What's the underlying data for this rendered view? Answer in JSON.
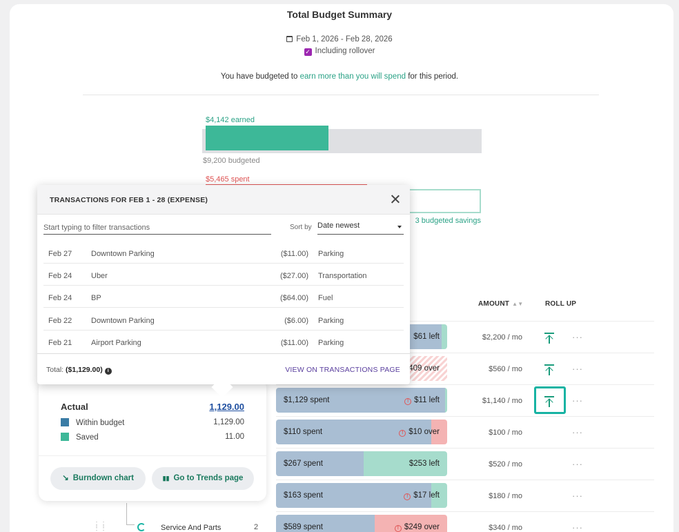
{
  "summary": {
    "title": "Total Budget Summary",
    "date_range": "Feb 1, 2026 - Feb 28, 2026",
    "rollover_label": "Including rollover",
    "message_prefix": "You have budgeted to ",
    "message_highlight": "earn more than you will spend",
    "message_suffix": " for this period.",
    "earned_label": "$4,142 earned",
    "budgeted_label": "$9,200 budgeted",
    "spent_label": "$5,465 spent",
    "savings_label": "3 budgeted savings",
    "earned_fraction": 0.45
  },
  "table": {
    "amount_header": "AMOUNT",
    "rollup_header": "ROLL UP",
    "rows": [
      {
        "bar_right": "$61 left",
        "amount": "$2,200 / mo",
        "rollup": true
      },
      {
        "bar_right": "409 over",
        "amount": "$560 / mo",
        "rollup": true
      },
      {
        "bar_left": "$1,129 spent",
        "bar_right": "$11 left",
        "amount": "$1,140 / mo",
        "rollup": true
      },
      {
        "bar_left": "$110 spent",
        "bar_right": "$10 over",
        "amount": "$100 / mo"
      },
      {
        "bar_left": "$267 spent",
        "bar_right": "$253 left",
        "amount": "$520 / mo"
      },
      {
        "bar_left": "$163 spent",
        "bar_right": "$17 left",
        "amount": "$180 / mo"
      },
      {
        "bar_left": "$589 spent",
        "bar_right": "$249 over",
        "amount": "$340 / mo"
      }
    ],
    "sub_category": {
      "name": "Service And Parts",
      "count": "2"
    },
    "dots": "···"
  },
  "breakdown": {
    "actual_label": "Actual",
    "actual_value": "1,129.00",
    "legend": [
      {
        "label": "Within budget",
        "value": "1,129.00",
        "color": "#3a7ca5"
      },
      {
        "label": "Saved",
        "value": "11.00",
        "color": "#3db898"
      }
    ],
    "burndown_button": "Burndown chart",
    "trends_button": "Go to Trends page"
  },
  "transactions": {
    "title": "TRANSACTIONS FOR FEB 1 - 28 (EXPENSE)",
    "filter_placeholder": "Start typing to filter transactions",
    "sort_label": "Sort by",
    "sort_value": "Date newest",
    "rows": [
      {
        "date": "Feb 27",
        "payee": "Downtown Parking",
        "amount": "($11.00)",
        "category": "Parking"
      },
      {
        "date": "Feb 24",
        "payee": "Uber",
        "amount": "($27.00)",
        "category": "Transportation"
      },
      {
        "date": "Feb 24",
        "payee": "BP",
        "amount": "($64.00)",
        "category": "Fuel"
      },
      {
        "date": "Feb 22",
        "payee": "Downtown Parking",
        "amount": "($6.00)",
        "category": "Parking"
      },
      {
        "date": "Feb 21",
        "payee": "Airport Parking",
        "amount": "($11.00)",
        "category": "Parking"
      }
    ],
    "total_label": "Total:",
    "total_value": "($1,129.00)",
    "view_link": "VIEW ON TRANSACTIONS PAGE"
  },
  "colors": {
    "accent": "#17b3a3",
    "earned": "#3db898",
    "spent_bar": "#a9bed3",
    "saved": "#a6dccc",
    "over": "#f4b3b3"
  }
}
